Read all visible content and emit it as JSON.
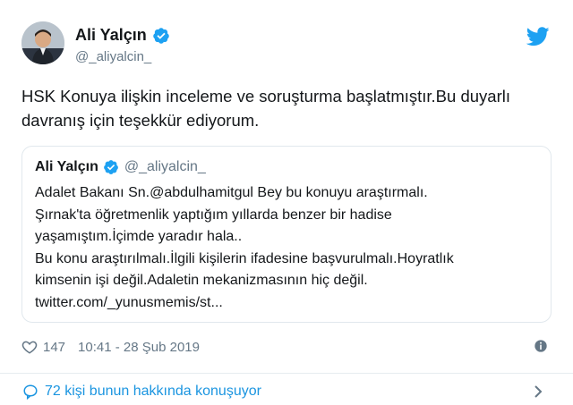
{
  "tweet": {
    "author_name": "Ali Yalçın",
    "handle": "@_aliyalcin_",
    "text": "HSK Konuya ilişkin inceleme ve soruşturma başlatmıştır.Bu duyarlı davranış için teşekkür ediyorum.",
    "likes": "147",
    "timestamp": "10:41 - 28 Şub 2019",
    "conversation_link": "72 kişi bunun hakkında konuşuyor"
  },
  "quote": {
    "author_name": "Ali Yalçın",
    "handle": "@_aliyalcin_",
    "lines": [
      "Adalet Bakanı Sn.@abdulhamitgul Bey bu konuyu araştırmalı.",
      "Şırnak'ta öğretmenlik yaptığım yıllarda benzer bir hadise",
      "yaşamıştım.İçimde yaradır hala..",
      "Bu konu araştırılmalı.İlgili kişilerin ifadesine başvurulmalı.Hoyratlık",
      "kimsenin işi değil.Adaletin mekanizmasının hiç değil.",
      "twitter.com/_yunusmemis/st..."
    ]
  },
  "icons": {
    "verified": "verified-badge-icon",
    "brand": "twitter-bird-icon",
    "like": "heart-icon",
    "info": "info-icon",
    "reply": "reply-bubble-icon",
    "chevron": "chevron-right-icon"
  },
  "colors": {
    "accent": "#1da1f2",
    "link": "#1b95e0",
    "secondary_text": "#657786",
    "border": "#e1e8ed"
  }
}
